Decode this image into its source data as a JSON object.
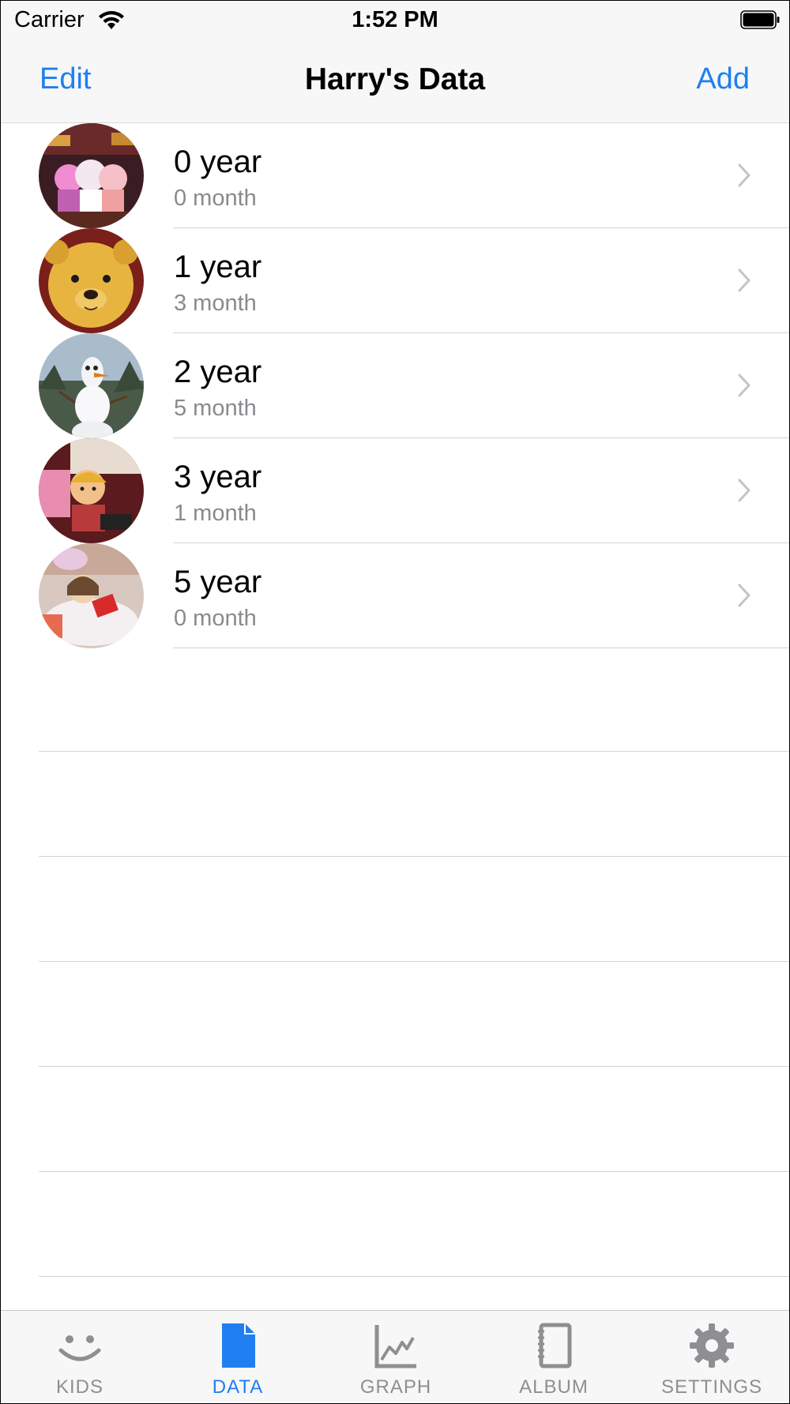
{
  "status_bar": {
    "carrier": "Carrier",
    "time": "1:52 PM"
  },
  "nav": {
    "left_button": "Edit",
    "title": "Harry's Data",
    "right_button": "Add"
  },
  "rows": [
    {
      "title": "0 year",
      "subtitle": "0 month",
      "image": "toy-figures-lights-photo"
    },
    {
      "title": "1 year",
      "subtitle": "3 month",
      "image": "pooh-bear-photo"
    },
    {
      "title": "2 year",
      "subtitle": "5 month",
      "image": "snowman-figure-photo"
    },
    {
      "title": "3 year",
      "subtitle": "1 month",
      "image": "toy-boy-piano-photo"
    },
    {
      "title": "5 year",
      "subtitle": "0 month",
      "image": "doll-figure-photo"
    }
  ],
  "tabs": [
    {
      "label": "KIDS",
      "icon": "smiley-face-icon",
      "active": false
    },
    {
      "label": "DATA",
      "icon": "document-icon",
      "active": true
    },
    {
      "label": "GRAPH",
      "icon": "line-chart-icon",
      "active": false
    },
    {
      "label": "ALBUM",
      "icon": "notebook-icon",
      "active": false
    },
    {
      "label": "SETTINGS",
      "icon": "gear-icon",
      "active": false
    }
  ],
  "colors": {
    "accent": "#1f7ff1",
    "inactive_tab": "#8e8e93",
    "separator": "#d4d4d4",
    "bar_background": "#f7f7f7"
  }
}
